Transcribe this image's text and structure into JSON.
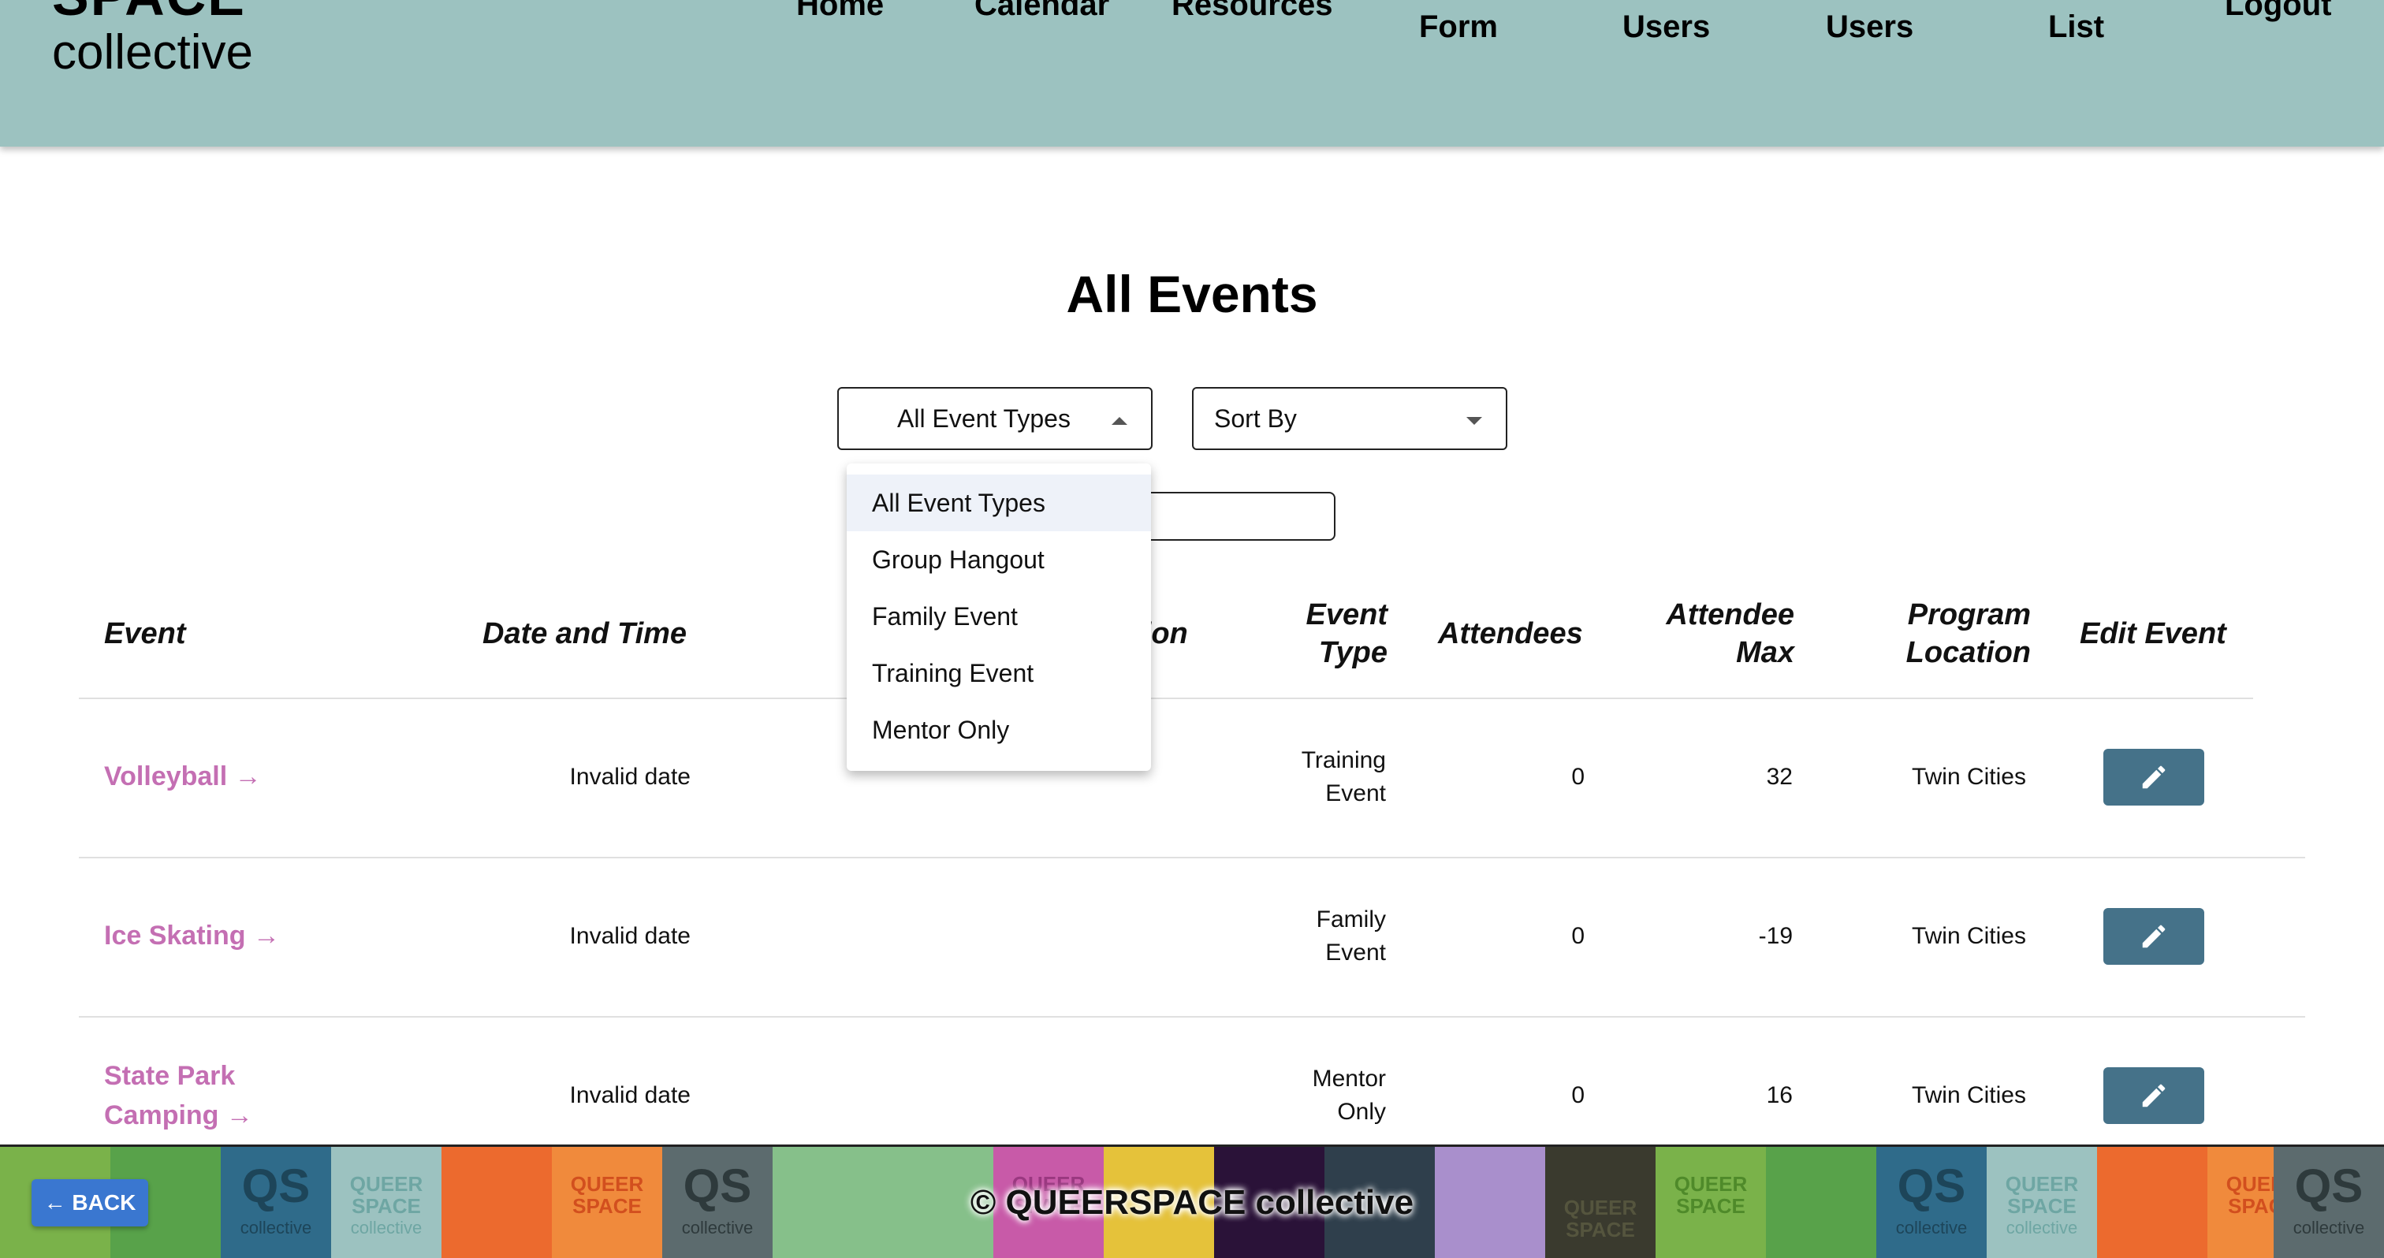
{
  "header": {
    "logo_top": "SPACE",
    "logo_bottom": "collective",
    "nav": [
      {
        "label": "Home"
      },
      {
        "label": "Calendar"
      },
      {
        "label": "Resources"
      },
      {
        "label": "Form"
      },
      {
        "label": "Users"
      },
      {
        "label": "Users"
      },
      {
        "label": "List"
      },
      {
        "label": "Logout"
      }
    ]
  },
  "page": {
    "title": "All Events"
  },
  "filters": {
    "event_type_selected": "All Event Types",
    "sort_by": "Sort By",
    "event_type_options": [
      {
        "label": "All Event Types",
        "selected": true
      },
      {
        "label": "Group Hangout"
      },
      {
        "label": "Family Event"
      },
      {
        "label": "Training Event"
      },
      {
        "label": "Mentor Only"
      }
    ]
  },
  "table": {
    "headers": {
      "event": "Event",
      "date_time": "Date and Time",
      "location_fragment": "ation",
      "event_type_1": "Event",
      "event_type_2": "Type",
      "attendees": "Attendees",
      "attendee_max_1": "Attendee",
      "attendee_max_2": "Max",
      "program_location_1": "Program",
      "program_location_2": "Location",
      "edit_event": "Edit Event"
    },
    "rows": [
      {
        "name_1": "Volleyball →",
        "name_2": "",
        "date": "Invalid date",
        "type_1": "Training",
        "type_2": "Event",
        "attendees": "0",
        "max": "32",
        "program_location": "Twin Cities"
      },
      {
        "name_1": "Ice Skating →",
        "name_2": "",
        "date": "Invalid date",
        "type_1": "Family",
        "type_2": "Event",
        "attendees": "0",
        "max": "-19",
        "program_location": "Twin Cities"
      },
      {
        "name_1": "State Park",
        "name_2": "Camping →",
        "date": "Invalid date",
        "type_1": "Mentor",
        "type_2": "Only",
        "attendees": "0",
        "max": "16",
        "program_location": "Twin Cities"
      }
    ]
  },
  "footer": {
    "copyright": "© QUEERSPACE collective",
    "back_label": "← BACK",
    "tile_word_1": "QUEER",
    "tile_word_2": "SPACE",
    "tile_word_3": "collective",
    "tile_mark": "QS"
  },
  "colors": {
    "header_bg": "#9cc2c0",
    "event_link": "#c46fb3",
    "edit_button": "#457289",
    "back_button": "#3a77d0"
  }
}
